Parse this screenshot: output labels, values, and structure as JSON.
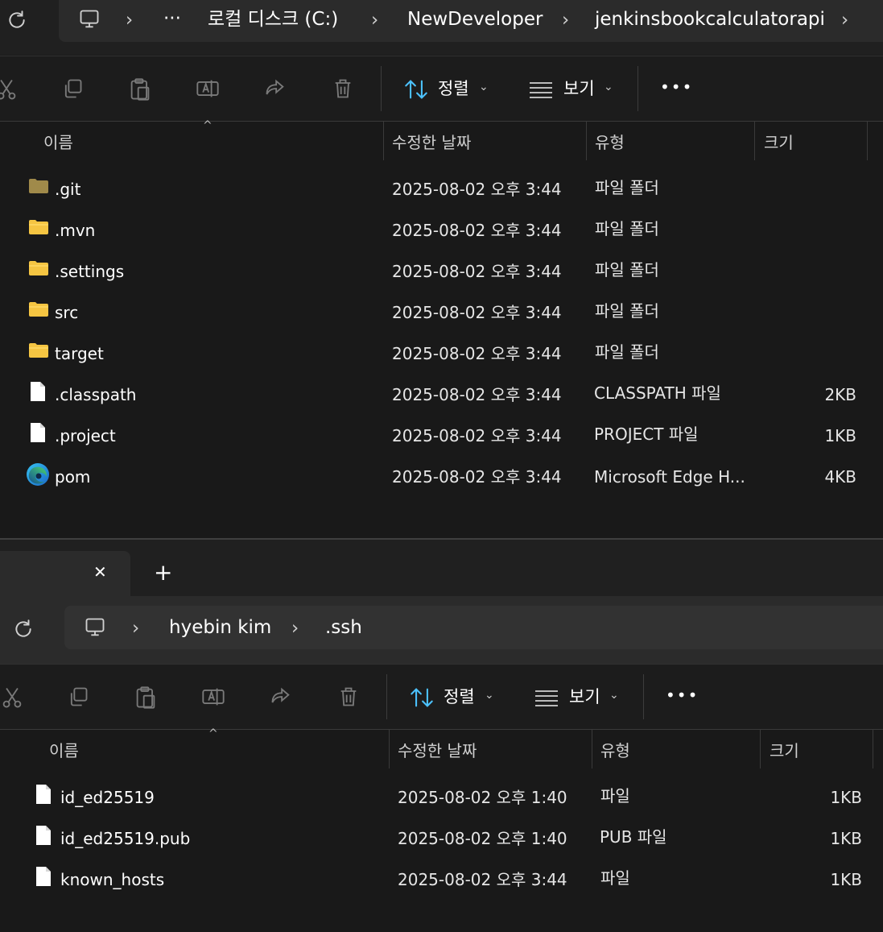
{
  "window1": {
    "breadcrumb": [
      "로컬 디스크 (C:)",
      "NewDeveloper",
      "jenkinsbookcalculatorapi"
    ],
    "more": "···",
    "toolbar": {
      "sort_label": "정렬",
      "view_label": "보기",
      "more": "•••"
    },
    "columns": [
      "이름",
      "수정한 날짜",
      "유형",
      "크기"
    ],
    "files": [
      {
        "name": ".git",
        "date": "2025-08-02 오후 3:44",
        "type": "파일 폴더",
        "size": "",
        "icon": "folder-icon-dim"
      },
      {
        "name": ".mvn",
        "date": "2025-08-02 오후 3:44",
        "type": "파일 폴더",
        "size": "",
        "icon": "folder-icon"
      },
      {
        "name": ".settings",
        "date": "2025-08-02 오후 3:44",
        "type": "파일 폴더",
        "size": "",
        "icon": "folder-icon"
      },
      {
        "name": "src",
        "date": "2025-08-02 오후 3:44",
        "type": "파일 폴더",
        "size": "",
        "icon": "folder-icon"
      },
      {
        "name": "target",
        "date": "2025-08-02 오후 3:44",
        "type": "파일 폴더",
        "size": "",
        "icon": "folder-icon"
      },
      {
        "name": ".classpath",
        "date": "2025-08-02 오후 3:44",
        "type": "CLASSPATH 파일",
        "size": "2KB",
        "icon": "file-icon"
      },
      {
        "name": ".project",
        "date": "2025-08-02 오후 3:44",
        "type": "PROJECT 파일",
        "size": "1KB",
        "icon": "file-icon"
      },
      {
        "name": "pom",
        "date": "2025-08-02 오후 3:44",
        "type": "Microsoft Edge H...",
        "size": "4KB",
        "icon": "edge-icon"
      }
    ]
  },
  "window2": {
    "tab": {
      "close": "✕",
      "new_tab": "+"
    },
    "breadcrumb": [
      "hyebin kim",
      ".ssh"
    ],
    "toolbar": {
      "sort_label": "정렬",
      "view_label": "보기",
      "more": "•••"
    },
    "columns": [
      "이름",
      "수정한 날짜",
      "유형",
      "크기"
    ],
    "files": [
      {
        "name": "id_ed25519",
        "date": "2025-08-02 오후 1:40",
        "type": "파일",
        "size": "1KB",
        "icon": "file-icon"
      },
      {
        "name": "id_ed25519.pub",
        "date": "2025-08-02 오후 1:40",
        "type": "PUB 파일",
        "size": "1KB",
        "icon": "file-icon"
      },
      {
        "name": "known_hosts",
        "date": "2025-08-02 오후 3:44",
        "type": "파일",
        "size": "1KB",
        "icon": "file-icon"
      }
    ]
  },
  "colors": {
    "background": "#1c1c1c",
    "folder": "#f5c542",
    "folder_dim": "#a08a4a",
    "file": "#ffffff",
    "accent": "#4cc2ff"
  }
}
